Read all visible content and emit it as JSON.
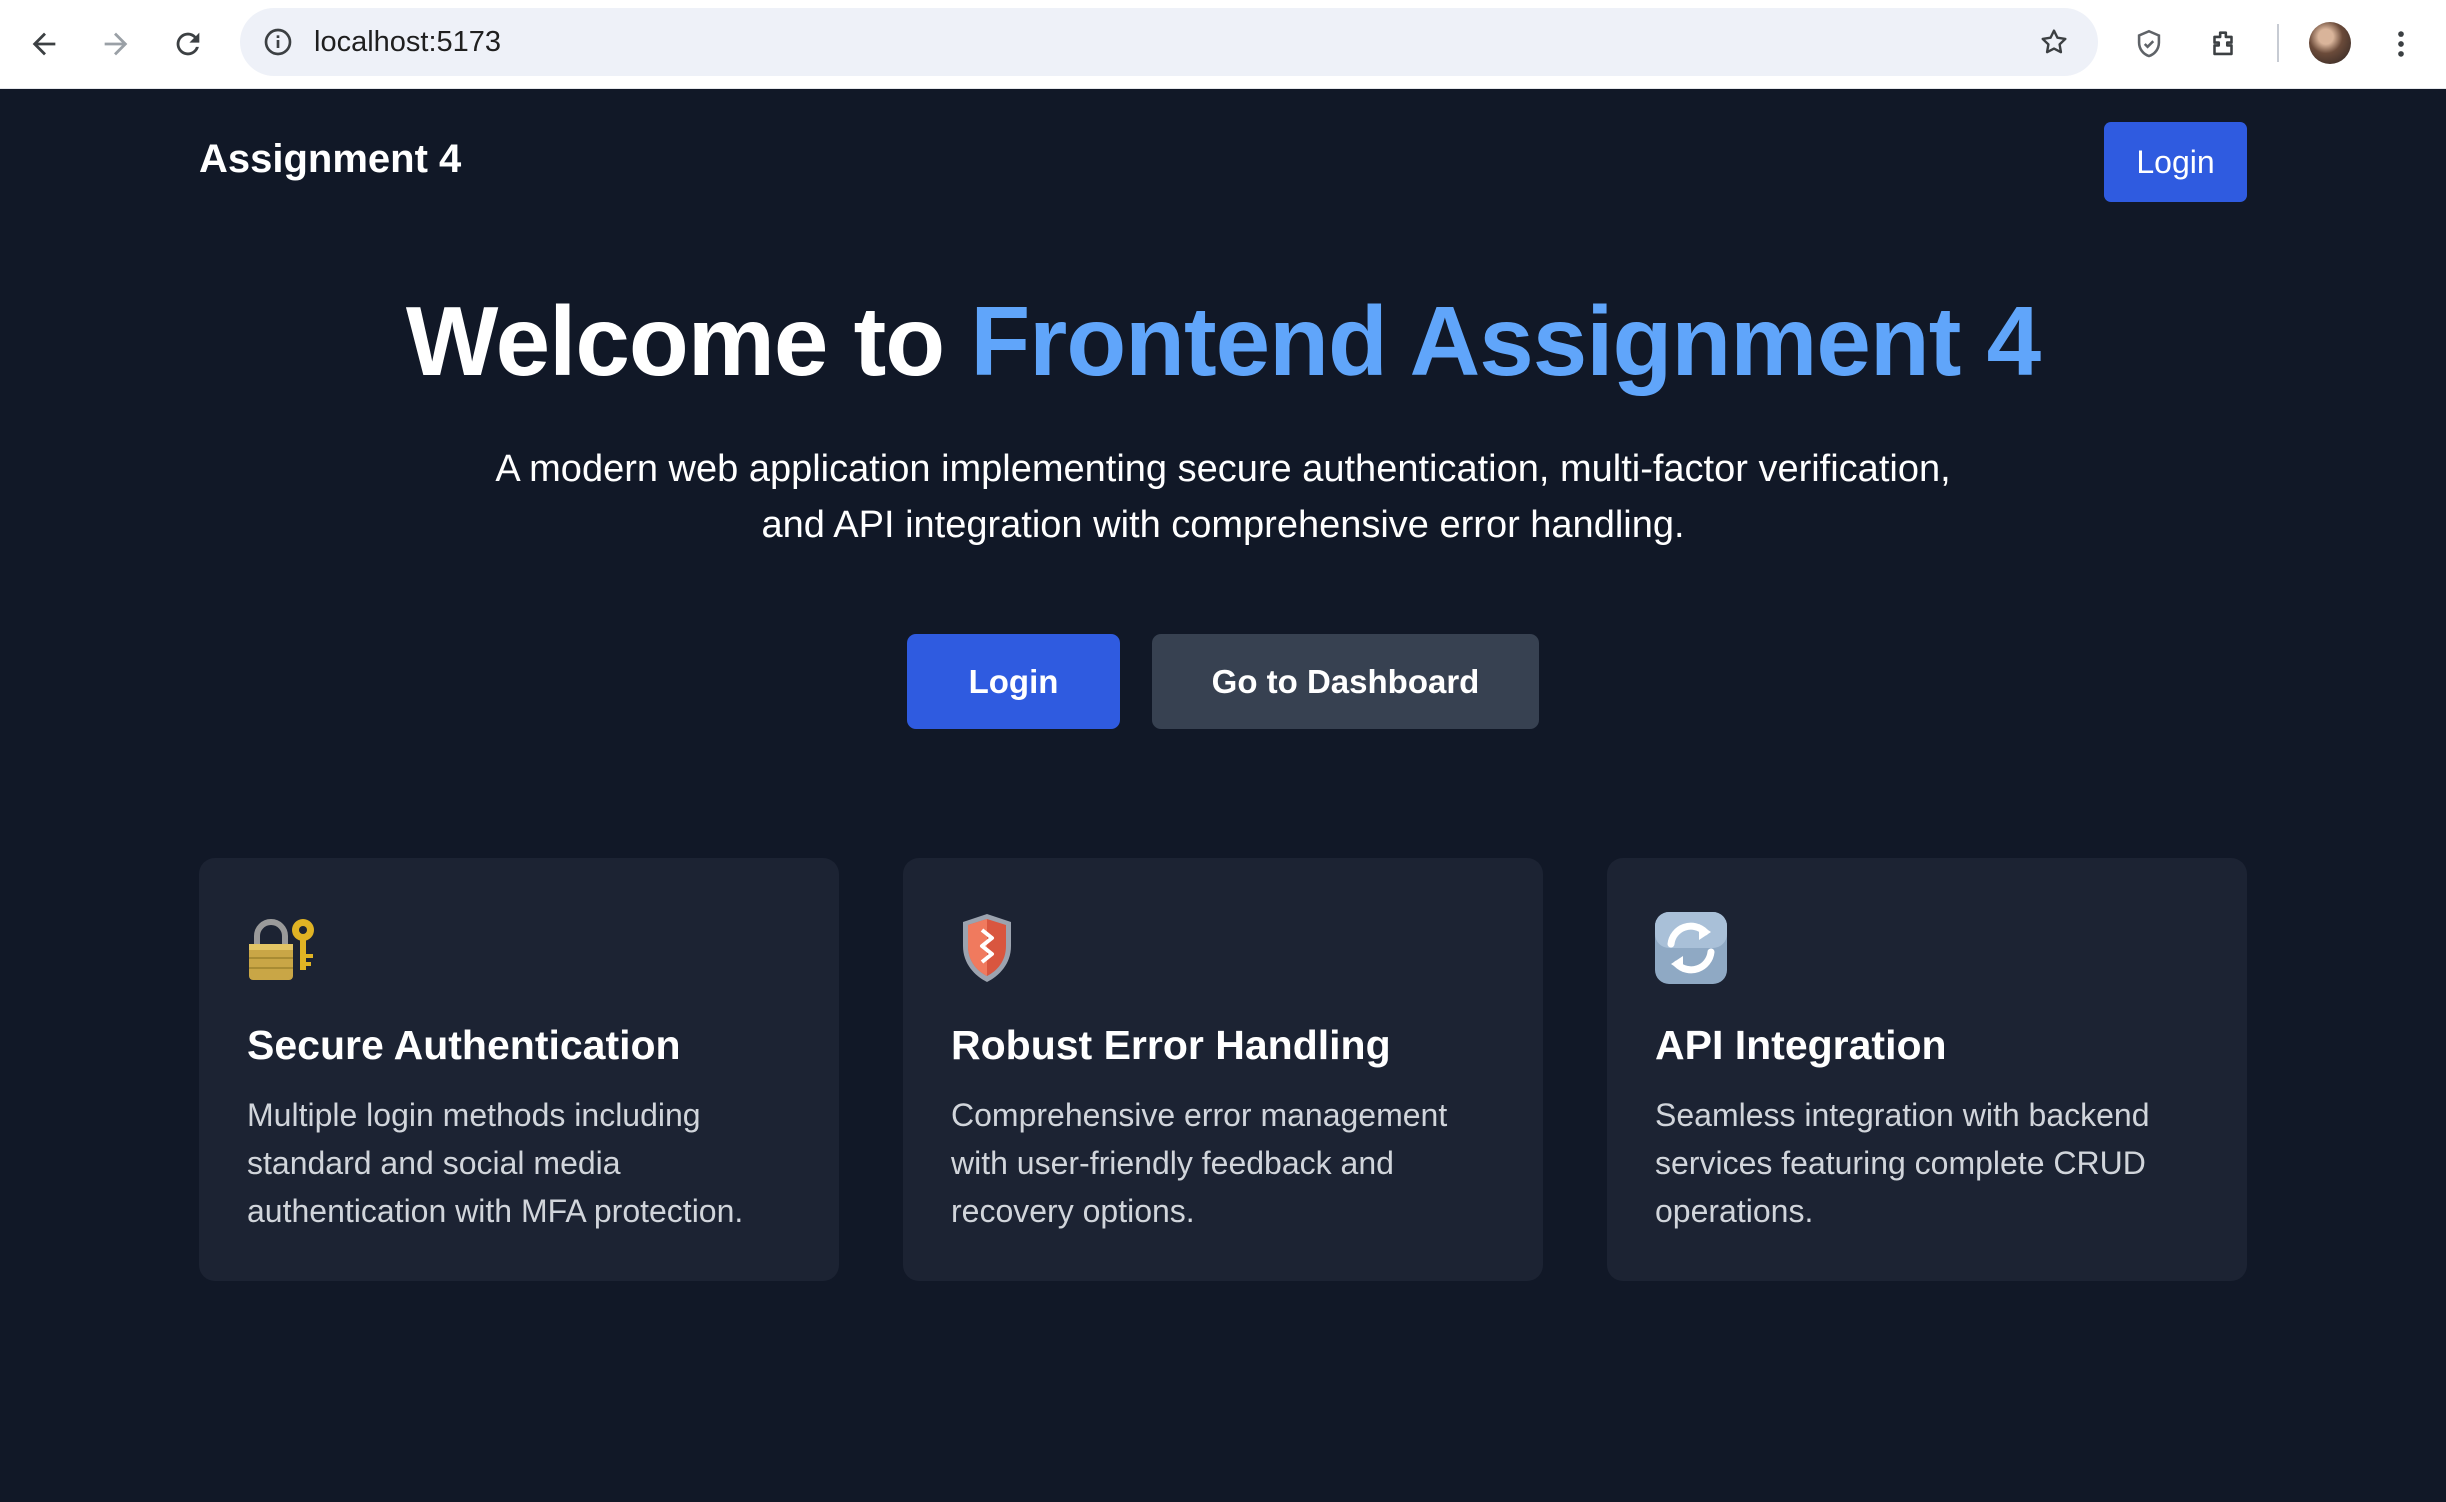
{
  "browser": {
    "url": "localhost:5173",
    "icons": [
      "back-arrow-icon",
      "forward-arrow-icon",
      "reload-icon",
      "site-info-icon",
      "bookmark-star-icon",
      "shield-icon",
      "extensions-icon",
      "profile-avatar",
      "more-menu-icon"
    ]
  },
  "header": {
    "brand": "Assignment 4",
    "login_label": "Login"
  },
  "hero": {
    "title_prefix": "Welcome to ",
    "title_accent": "Frontend Assignment 4",
    "subtitle_line1": "A modern web application implementing secure authentication, multi-factor verification,",
    "subtitle_line2": "and API integration with comprehensive error handling.",
    "login_label": "Login",
    "dashboard_label": "Go to Dashboard"
  },
  "features": [
    {
      "icon": "lock-with-key-icon",
      "title": "Secure Authentication",
      "text": "Multiple login methods including standard and social media authentication with MFA protection."
    },
    {
      "icon": "shield-icon",
      "title": "Robust Error Handling",
      "text": "Comprehensive error management with user-friendly feedback and recovery options."
    },
    {
      "icon": "refresh-arrows-icon",
      "title": "API Integration",
      "text": "Seamless integration with backend services featuring complete CRUD operations."
    }
  ],
  "colors": {
    "background": "#111827",
    "card": "#1c2333",
    "primary": "#2f5be0",
    "secondary": "#374151",
    "accent": "#60a5fa"
  }
}
